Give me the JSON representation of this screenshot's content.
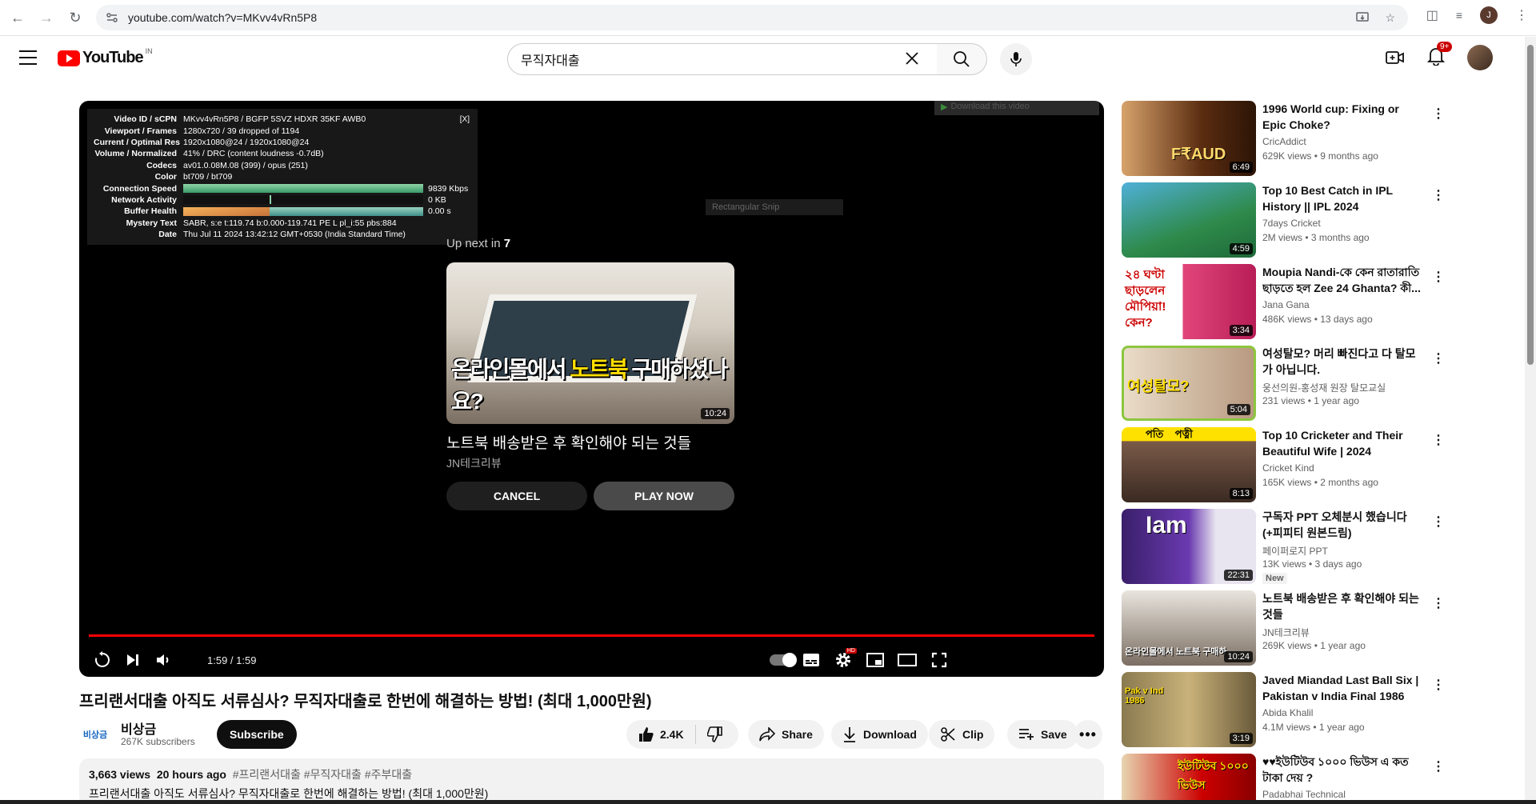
{
  "browser": {
    "url": "youtube.com/watch?v=MKvv4vRn5P8",
    "profile_initial": "J"
  },
  "header": {
    "logo_text": "YouTube",
    "country": "IN",
    "search_value": "무직자대출",
    "notif_count": "9+"
  },
  "player": {
    "stats": [
      {
        "k": "Video ID / sCPN",
        "v": "MKvv4vRn5P8  /  BGFP 5SVZ HDXR 35KF AWB0"
      },
      {
        "k": "Viewport / Frames",
        "v": "1280x720 / 39 dropped of 1194"
      },
      {
        "k": "Current / Optimal Res",
        "v": "1920x1080@24 / 1920x1080@24"
      },
      {
        "k": "Volume / Normalized",
        "v": "41% / DRC (content loudness -0.7dB)"
      },
      {
        "k": "Codecs",
        "v": "av01.0.08M.08 (399) / opus (251)"
      },
      {
        "k": "Color",
        "v": "bt709 / bt709"
      },
      {
        "k": "Connection Speed",
        "v": "9839 Kbps"
      },
      {
        "k": "Network Activity",
        "v": "0 KB"
      },
      {
        "k": "Buffer Health",
        "v": "0.00 s"
      },
      {
        "k": "Mystery Text",
        "v": "SABR, s:e t:119.74 b:0.000-119.741 PE L pl_i:55 pbs:884"
      },
      {
        "k": "Date",
        "v": "Thu Jul 11 2024 13:42:12 GMT+0530 (India Standard Time)"
      }
    ],
    "stats_close": "[X]",
    "download_overlay": "Download this video",
    "snip_label": "Rectangular Snip",
    "upnext_prefix": "Up next in",
    "upnext_count": "7",
    "upnext_title": "노트북 배송받은 후 확인해야 되는 것들",
    "upnext_channel": "JN테크리뷰",
    "upnext_duration": "10:24",
    "upnext_thumb_text_a": "온라인몰에서 ",
    "upnext_thumb_text_b": "노트북",
    "upnext_thumb_text_c": " 구매하셨나요?",
    "cancel_label": "CANCEL",
    "play_label": "PLAY NOW",
    "time": "1:59 / 1:59",
    "progress": 1.0
  },
  "video": {
    "title": "프리랜서대출 아직도 서류심사? 무직자대출로 한번에 해결하는 방법! (최대 1,000만원)",
    "channel_logo": "비상금",
    "channel": "비상금",
    "subscribers": "267K subscribers",
    "subscribe_label": "Subscribe",
    "likes": "2.4K",
    "share_label": "Share",
    "download_label": "Download",
    "clip_label": "Clip",
    "save_label": "Save",
    "views": "3,663 views",
    "age": "20 hours ago",
    "tags": "#프리랜서대출 #무직자대출 #주부대출",
    "desc_line": "프리랜서대출 아직도 서류심사? 무직자대출로 한번에 해결하는 방법! (최대 1,000만원)"
  },
  "sidebar": {
    "items": [
      {
        "title": "1996 World cup: Fixing or Epic Choke?",
        "channel": "CricAddict",
        "stats": "629K views  •  9 months ago",
        "duration": "6:49",
        "thumb_text": "F₹AUD"
      },
      {
        "title": "Top 10 Best Catch in IPL History || IPL 2024",
        "channel": "7days Cricket",
        "stats": "2M views  •  3 months ago",
        "duration": "4:59",
        "thumb_text": ""
      },
      {
        "title": "Moupia Nandi-কে কেন রাতারাতি ছাড়তে হল Zee 24 Ghanta? কী...",
        "channel": "Jana Gana",
        "stats": "486K views  •  13 days ago",
        "duration": "3:34",
        "thumb_text": "২৪ ঘণ্টা ছাড়লেন মৌপিয়া! কেন?"
      },
      {
        "title": "여성탈모? 머리 빠진다고 다 탈모가 아닙니다.",
        "channel": "웅선의원-홍성재 원장 탈모교실",
        "stats": "231 views  •  1 year ago",
        "duration": "5:04",
        "thumb_text": "여성탈모?"
      },
      {
        "title": "Top 10 Cricketer and Their Beautiful Wife | 2024",
        "channel": "Cricket Kind",
        "stats": "165K views  •  2 months ago",
        "duration": "8:13",
        "thumb_text": "পতি    পত্নী"
      },
      {
        "title": "구독자 PPT 오체분시 했습니다 (+피피티 원본드림)",
        "channel": "페이퍼로지 PPT",
        "stats": "13K views  •  3 days ago",
        "duration": "22:31",
        "thumb_text": "Iam",
        "badge": "New"
      },
      {
        "title": "노트북 배송받은 후 확인해야 되는 것들",
        "channel": "JN테크리뷰",
        "stats": "269K views  •  1 year ago",
        "duration": "10:24",
        "thumb_text": "온라인몰에서 노트북 구매하"
      },
      {
        "title": "Javed Miandad Last Ball Six | Pakistan v India Final 1986",
        "channel": "Abida Khalil",
        "stats": "4.1M views  •  1 year ago",
        "duration": "3:19",
        "thumb_text": "Pak v Ind 1986"
      },
      {
        "title": "♥♥ইউটিউব ১০০০ ভিউস এ কত টাকা দেয় ?",
        "channel": "Padabhai Technical",
        "stats": "",
        "duration": "",
        "thumb_text": "ইউটিউব ১০০০ ভিউস"
      }
    ]
  }
}
